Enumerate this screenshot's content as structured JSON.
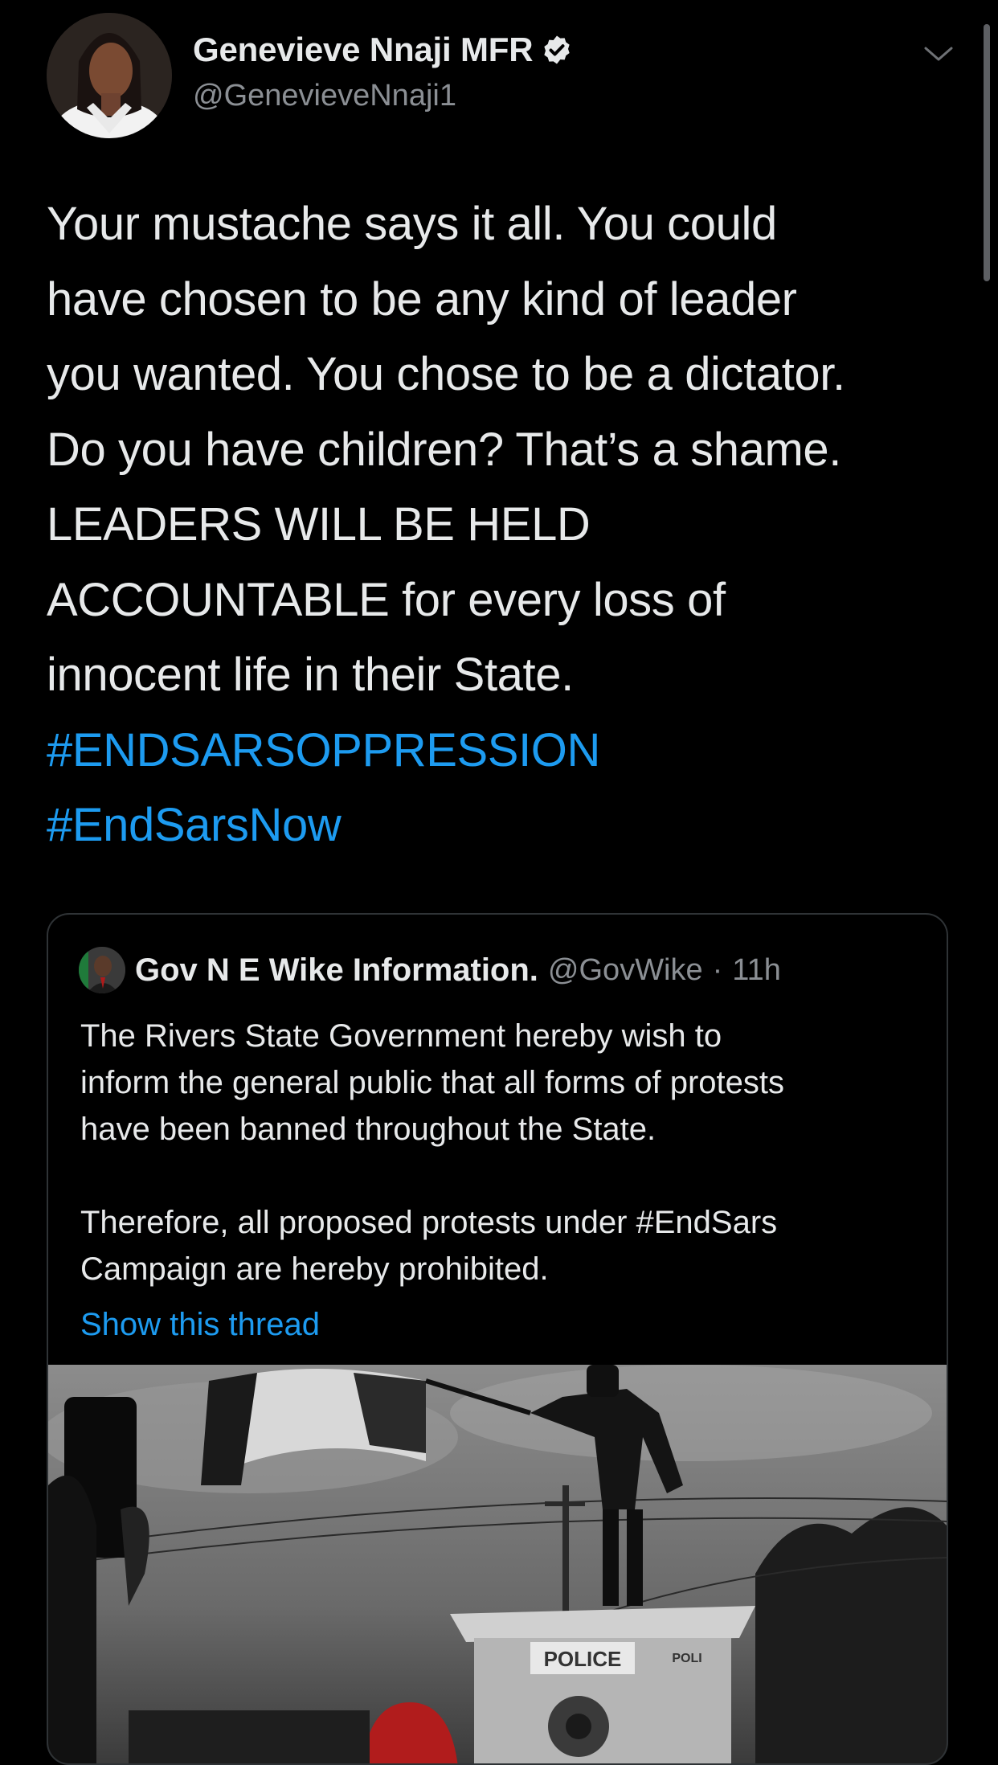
{
  "author": {
    "display_name": "Genevieve Nnaji MFR",
    "handle": "@GenevieveNnaji1",
    "verified": true,
    "avatar_icon": "profile-photo"
  },
  "tweet": {
    "lines": [
      "Your mustache says it all. You could",
      "have chosen to be any kind of leader",
      "you wanted. You chose to be a dictator.",
      "Do you have children? That’s a shame.",
      "LEADERS WILL BE HELD",
      "ACCOUNTABLE for every loss of",
      "innocent life in their State."
    ],
    "hashtags": [
      "#ENDSARSOPPRESSION",
      "#EndSarsNow"
    ]
  },
  "quote": {
    "display_name": "Gov N E Wike Information.",
    "handle": "@GovWike",
    "separator": "·",
    "time": "11h",
    "paragraph1": [
      "The Rivers State Government hereby wish to",
      "inform the general public that all forms of protests",
      "have been banned throughout the State."
    ],
    "paragraph2": [
      "Therefore, all proposed protests under #EndSars",
      "Campaign are hereby prohibited."
    ],
    "show_thread": "Show this thread",
    "image_sign_text": "POLICE",
    "image_sign_text_2": "POLI"
  },
  "colors": {
    "background": "#000000",
    "text": "#e7e9ea",
    "secondary": "#8b8f94",
    "link": "#1d9bf0",
    "border": "#2f3336"
  }
}
